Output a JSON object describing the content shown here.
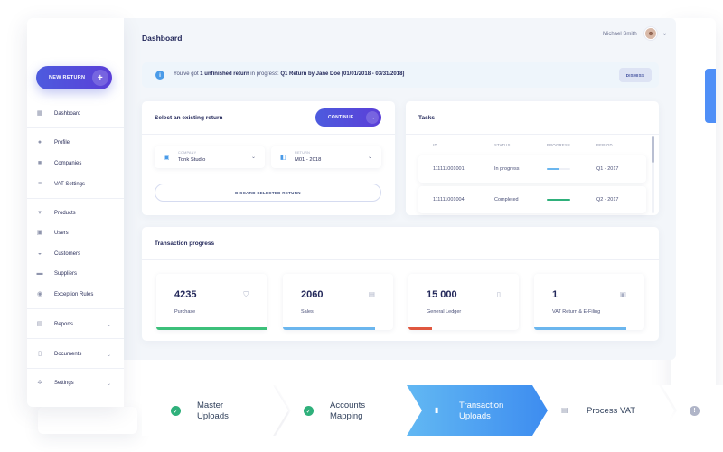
{
  "header": {
    "title": "Dashboard",
    "user_name": "Michael Smith"
  },
  "sidebar": {
    "new_return_label": "NEW RETURN",
    "items": [
      {
        "label": "Dashboard",
        "icon": "grid-icon"
      },
      {
        "label": "Profile",
        "icon": "user-icon"
      },
      {
        "label": "Companies",
        "icon": "building-icon"
      },
      {
        "label": "VAT Settings",
        "icon": "sliders-icon"
      },
      {
        "label": "Products",
        "icon": "cart-icon"
      },
      {
        "label": "Users",
        "icon": "users-icon"
      },
      {
        "label": "Customers",
        "icon": "customers-icon"
      },
      {
        "label": "Suppliers",
        "icon": "truck-icon"
      },
      {
        "label": "Exception Rules",
        "icon": "rules-icon"
      },
      {
        "label": "Reports",
        "icon": "report-icon"
      },
      {
        "label": "Documents",
        "icon": "document-icon"
      },
      {
        "label": "Settings",
        "icon": "gear-icon"
      }
    ]
  },
  "notice": {
    "prefix": "You've got ",
    "count_text": "1 unfinished return",
    "middle": " in progress: ",
    "return_text": "Q1 Return by Jane Doe [01/01/2018 - 03/31/2018]",
    "dismiss_label": "DISMISS"
  },
  "existing_return": {
    "title": "Select an existing return",
    "continue_label": "CONTINUE",
    "company_label": "COMPANY",
    "company_value": "Tonk Studio",
    "return_label": "RETURN",
    "return_value": "M01 - 2018",
    "discard_label": "DISCARD SELECTED RETURN"
  },
  "tasks": {
    "title": "Tasks",
    "columns": [
      "ID",
      "STATUS",
      "PROGRESS",
      "PERIOD"
    ],
    "rows": [
      {
        "id": "111111001001",
        "status": "In progress",
        "progress": 0.55,
        "period": "Q1 - 2017",
        "color": "#6bb6ee"
      },
      {
        "id": "111111001004",
        "status": "Completed",
        "progress": 1.0,
        "period": "Q2 - 2017",
        "color": "#2fb07b"
      }
    ]
  },
  "transaction": {
    "title": "Transaction progress",
    "metrics": [
      {
        "value": "4235",
        "label": "Purchase",
        "icon": "basket-icon",
        "color": "#3cc07a"
      },
      {
        "value": "2060",
        "label": "Sales",
        "icon": "store-icon",
        "color": "#6bb6ee"
      },
      {
        "value": "15 000",
        "label": "General Ledger",
        "icon": "ledger-icon",
        "color": "#e0573f"
      },
      {
        "value": "1",
        "label": "VAT Return & E-Filing",
        "icon": "filing-icon",
        "color": "#6bb6ee"
      }
    ]
  },
  "stepper": {
    "steps": [
      {
        "line1": "Master",
        "line2": "Uploads",
        "state": "done"
      },
      {
        "line1": "Accounts",
        "line2": "Mapping",
        "state": "done"
      },
      {
        "line1": "Transaction",
        "line2": "Uploads",
        "state": "active"
      },
      {
        "line1": "Process VAT",
        "line2": "",
        "state": "pending"
      },
      {
        "line1": "",
        "line2": "",
        "state": "info"
      }
    ]
  },
  "colors": {
    "accent": "#4d5bde",
    "info": "#4a9be8",
    "success": "#2fb07b",
    "danger": "#e0573f"
  }
}
